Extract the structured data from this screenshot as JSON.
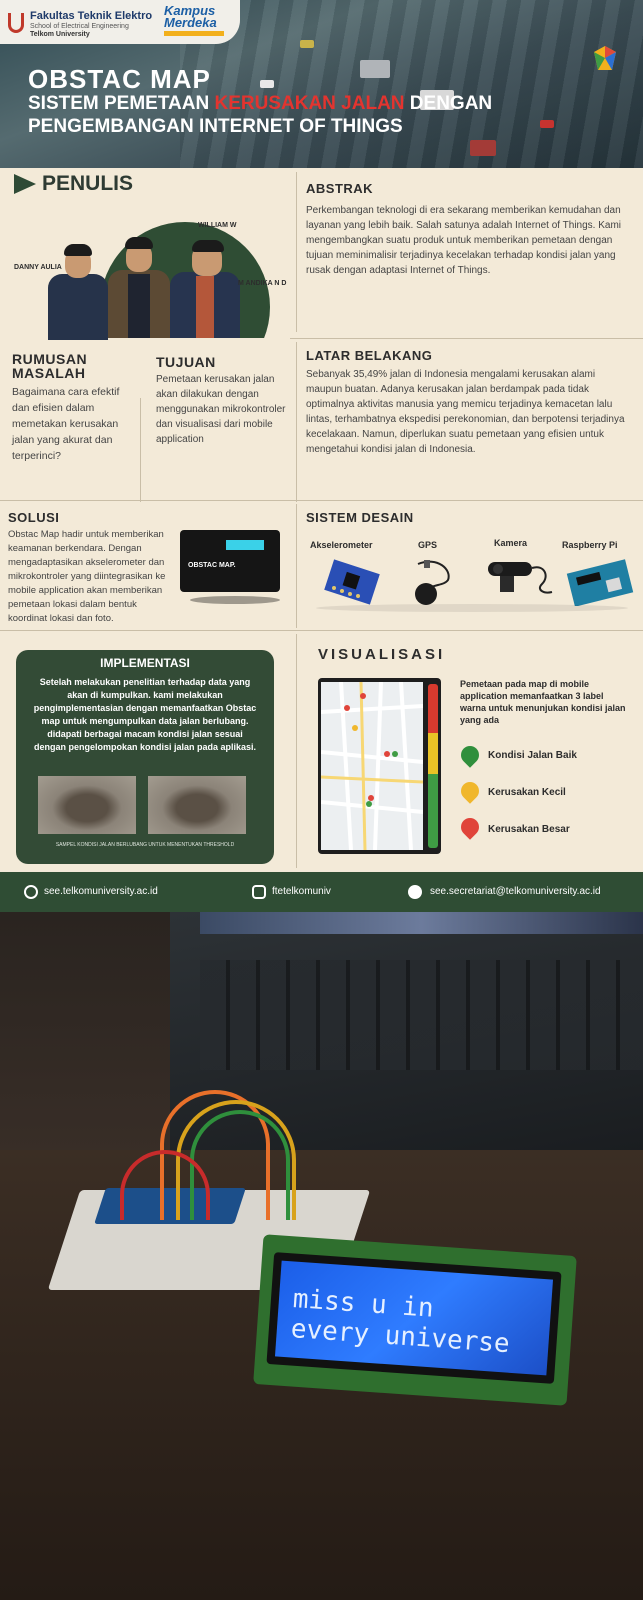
{
  "header": {
    "logo_fte": "Fakultas Teknik Elektro",
    "logo_sub1": "School of Electrical Engineering",
    "logo_sub2": "Telkom University",
    "logo_km": "Kampus Merdeka",
    "title": "OBSTAC MAP",
    "subtitle_pre": "SISTEM PEMETAAN ",
    "subtitle_red": "KERUSAKAN JALAN",
    "subtitle_post": " DENGAN",
    "subtitle_line2": "PENGEMBANGAN INTERNET OF THINGS"
  },
  "penulis": {
    "title": "PENULIS",
    "names": [
      "DANNY AULIA",
      "WILLIAM W",
      "M ANDIKA N D"
    ]
  },
  "abstrak": {
    "title": "ABSTRAK",
    "text": "Perkembangan teknologi di era sekarang memberikan kemudahan dan layanan yang lebih baik. Salah satunya adalah Internet of Things. Kami mengembangkan suatu produk untuk memberikan pemetaan dengan tujuan meminimalisir terjadinya kecelakan terhadap kondisi jalan yang rusak dengan adaptasi Internet of Things."
  },
  "rumusan": {
    "title_line1": "RUMUSAN",
    "title_line2": "MASALAH",
    "text": "Bagaimana cara efektif dan efisien dalam memetakan kerusakan jalan yang akurat dan terperinci?"
  },
  "tujuan": {
    "title": "TUJUAN",
    "text": "Pemetaan kerusakan jalan akan dilakukan dengan menggunakan mikrokontroler dan visualisasi dari mobile application"
  },
  "latar": {
    "title": "LATAR BELAKANG",
    "text": "Sebanyak 35,49% jalan di Indonesia mengalami kerusakan alami maupun buatan. Adanya kerusakan jalan berdampak pada tidak optimalnya aktivitas manusia yang memicu terjadinya kemacetan lalu lintas, terhambatnya ekspedisi perekonomian, dan berpotensi terjadinya kecelakaan. Namun, diperlukan suatu pemetaan yang efisien untuk mengetahui kondisi jalan di Indonesia."
  },
  "solusi": {
    "title": "SOLUSI",
    "text": "Obstac Map hadir untuk memberikan keamanan berkendara. Dengan mengadaptasikan akselerometer dan mikrokontroler yang diintegrasikan ke mobile application akan memberikan pemetaan lokasi dalam bentuk koordinat lokasi dan foto.",
    "device_label": "OBSTAC MAP."
  },
  "sistem": {
    "title": "SISTEM DESAIN",
    "components": [
      "Akselerometer",
      "GPS",
      "Kamera",
      "Raspberry Pi"
    ]
  },
  "implementasi": {
    "title": "IMPLEMENTASI",
    "text": "Setelah melakukan penelitian terhadap data yang akan di kumpulkan. kami melakukan pengimplementasian dengan memanfaatkan Obstac map untuk mengumpulkan data jalan berlubang. didapati berbagai macam kondisi jalan sesuai dengan pengelompokan kondisi jalan pada aplikasi.",
    "caption": "SAMPEL KONDISI JALAN BERLUBANG UNTUK MENENTUKAN THRESHOLD"
  },
  "visualisasi": {
    "title": "VISUALISASI",
    "text": "Pemetaan pada map di mobile application memanfaatkan 3 label warna untuk menunjukan kondisi jalan yang ada",
    "legend": [
      {
        "label": "Kondisi Jalan Baik",
        "color": "#2f8f3c"
      },
      {
        "label": "Kerusakan Kecil",
        "color": "#f0b72c"
      },
      {
        "label": "Kerusakan Besar",
        "color": "#e0443a"
      }
    ]
  },
  "footer": {
    "website": "see.telkomuniversity.ac.id",
    "instagram": "ftetelkomuniv",
    "email": "see.secretariat@telkomuniversity.ac.id"
  },
  "photo": {
    "lcd_line1": "miss u in",
    "lcd_line2": "every universe"
  },
  "colors": {
    "dark_green": "#2f4d34",
    "beige": "#f3ead8",
    "accent_red": "#e3342f"
  }
}
